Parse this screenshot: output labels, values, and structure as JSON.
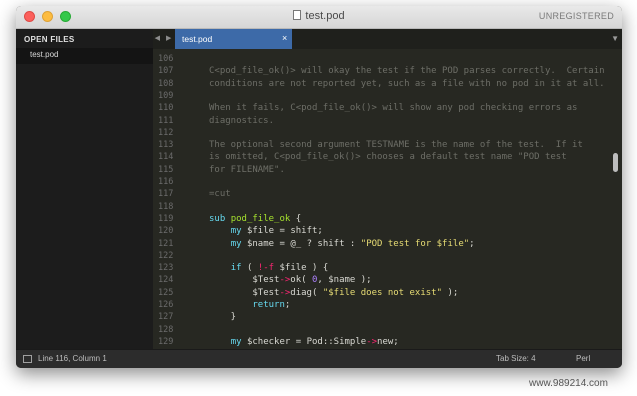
{
  "window": {
    "title": "test.pod",
    "registration": "UNREGISTERED"
  },
  "sidebar": {
    "header": "OPEN FILES",
    "files": [
      "test.pod"
    ]
  },
  "tabs": [
    {
      "label": "test.pod",
      "active": true,
      "close": "×"
    }
  ],
  "tabbar": {
    "nav": "◀ ▶",
    "overflow": "▼"
  },
  "editor": {
    "lines": [
      {
        "n": "106",
        "segs": []
      },
      {
        "n": "107",
        "segs": [
          {
            "c": "com",
            "t": "C<pod_file_ok()> will okay the test if the POD parses correctly.  Certain"
          }
        ]
      },
      {
        "n": "108",
        "segs": [
          {
            "c": "com",
            "t": "conditions are not reported yet, such as a file with no pod in it at all."
          }
        ]
      },
      {
        "n": "109",
        "segs": []
      },
      {
        "n": "110",
        "segs": [
          {
            "c": "com",
            "t": "When it fails, C<pod_file_ok()> will show any pod checking errors as"
          }
        ]
      },
      {
        "n": "111",
        "segs": [
          {
            "c": "com",
            "t": "diagnostics."
          }
        ]
      },
      {
        "n": "112",
        "segs": []
      },
      {
        "n": "113",
        "segs": [
          {
            "c": "com",
            "t": "The optional second argument TESTNAME is the name of the test.  If it"
          }
        ]
      },
      {
        "n": "114",
        "segs": [
          {
            "c": "com",
            "t": "is omitted, C<pod_file_ok()> chooses a default test name \"POD test"
          }
        ]
      },
      {
        "n": "115",
        "segs": [
          {
            "c": "com",
            "t": "for FILENAME\"."
          }
        ]
      },
      {
        "n": "116",
        "segs": []
      },
      {
        "n": "117",
        "segs": [
          {
            "c": "com",
            "t": "=cut"
          }
        ]
      },
      {
        "n": "118",
        "segs": []
      },
      {
        "n": "119",
        "segs": [
          {
            "c": "kw",
            "t": "sub "
          },
          {
            "c": "fn",
            "t": "pod_file_ok"
          },
          {
            "c": "plain",
            "t": " {"
          }
        ]
      },
      {
        "n": "120",
        "segs": [
          {
            "c": "plain",
            "t": "    "
          },
          {
            "c": "kw",
            "t": "my "
          },
          {
            "c": "var",
            "t": "$file"
          },
          {
            "c": "plain",
            "t": " = "
          },
          {
            "c": "plain",
            "t": "shift"
          },
          {
            "c": "plain",
            "t": ";"
          }
        ]
      },
      {
        "n": "121",
        "segs": [
          {
            "c": "plain",
            "t": "    "
          },
          {
            "c": "kw",
            "t": "my "
          },
          {
            "c": "var",
            "t": "$name"
          },
          {
            "c": "plain",
            "t": " = "
          },
          {
            "c": "var",
            "t": "@_"
          },
          {
            "c": "plain",
            "t": " ? "
          },
          {
            "c": "plain",
            "t": "shift"
          },
          {
            "c": "plain",
            "t": " : "
          },
          {
            "c": "str",
            "t": "\"POD test for $file\""
          },
          {
            "c": "plain",
            "t": ";"
          }
        ]
      },
      {
        "n": "122",
        "segs": []
      },
      {
        "n": "123",
        "segs": [
          {
            "c": "plain",
            "t": "    "
          },
          {
            "c": "kw",
            "t": "if"
          },
          {
            "c": "plain",
            "t": " ( "
          },
          {
            "c": "op",
            "t": "!-f"
          },
          {
            "c": "plain",
            "t": " "
          },
          {
            "c": "var",
            "t": "$file"
          },
          {
            "c": "plain",
            "t": " ) {"
          }
        ]
      },
      {
        "n": "124",
        "segs": [
          {
            "c": "plain",
            "t": "        "
          },
          {
            "c": "var",
            "t": "$Test"
          },
          {
            "c": "op",
            "t": "->"
          },
          {
            "c": "plain",
            "t": "ok( "
          },
          {
            "c": "num",
            "t": "0"
          },
          {
            "c": "plain",
            "t": ", "
          },
          {
            "c": "var",
            "t": "$name"
          },
          {
            "c": "plain",
            "t": " );"
          }
        ]
      },
      {
        "n": "125",
        "segs": [
          {
            "c": "plain",
            "t": "        "
          },
          {
            "c": "var",
            "t": "$Test"
          },
          {
            "c": "op",
            "t": "->"
          },
          {
            "c": "plain",
            "t": "diag( "
          },
          {
            "c": "str",
            "t": "\"$file does not exist\""
          },
          {
            "c": "plain",
            "t": " );"
          }
        ]
      },
      {
        "n": "126",
        "segs": [
          {
            "c": "plain",
            "t": "        "
          },
          {
            "c": "kw",
            "t": "return"
          },
          {
            "c": "plain",
            "t": ";"
          }
        ]
      },
      {
        "n": "127",
        "segs": [
          {
            "c": "plain",
            "t": "    }"
          }
        ]
      },
      {
        "n": "128",
        "segs": []
      },
      {
        "n": "129",
        "segs": [
          {
            "c": "plain",
            "t": "    "
          },
          {
            "c": "kw",
            "t": "my "
          },
          {
            "c": "var",
            "t": "$checker"
          },
          {
            "c": "plain",
            "t": " = "
          },
          {
            "c": "plain",
            "t": "Pod::Simple"
          },
          {
            "c": "op",
            "t": "->"
          },
          {
            "c": "plain",
            "t": "new;"
          }
        ]
      }
    ]
  },
  "status": {
    "position": "Line 116, Column 1",
    "tab_size": "Tab Size: 4",
    "syntax": "Perl"
  },
  "watermark": "www.989214.com",
  "colors": {
    "background": "#272822",
    "comment": "#6d6e67",
    "keyword": "#66d9ef",
    "string": "#e6db74",
    "function": "#a6e22e",
    "operator": "#f92672",
    "number": "#ae81ff",
    "tab_active": "#3d6aa8"
  }
}
